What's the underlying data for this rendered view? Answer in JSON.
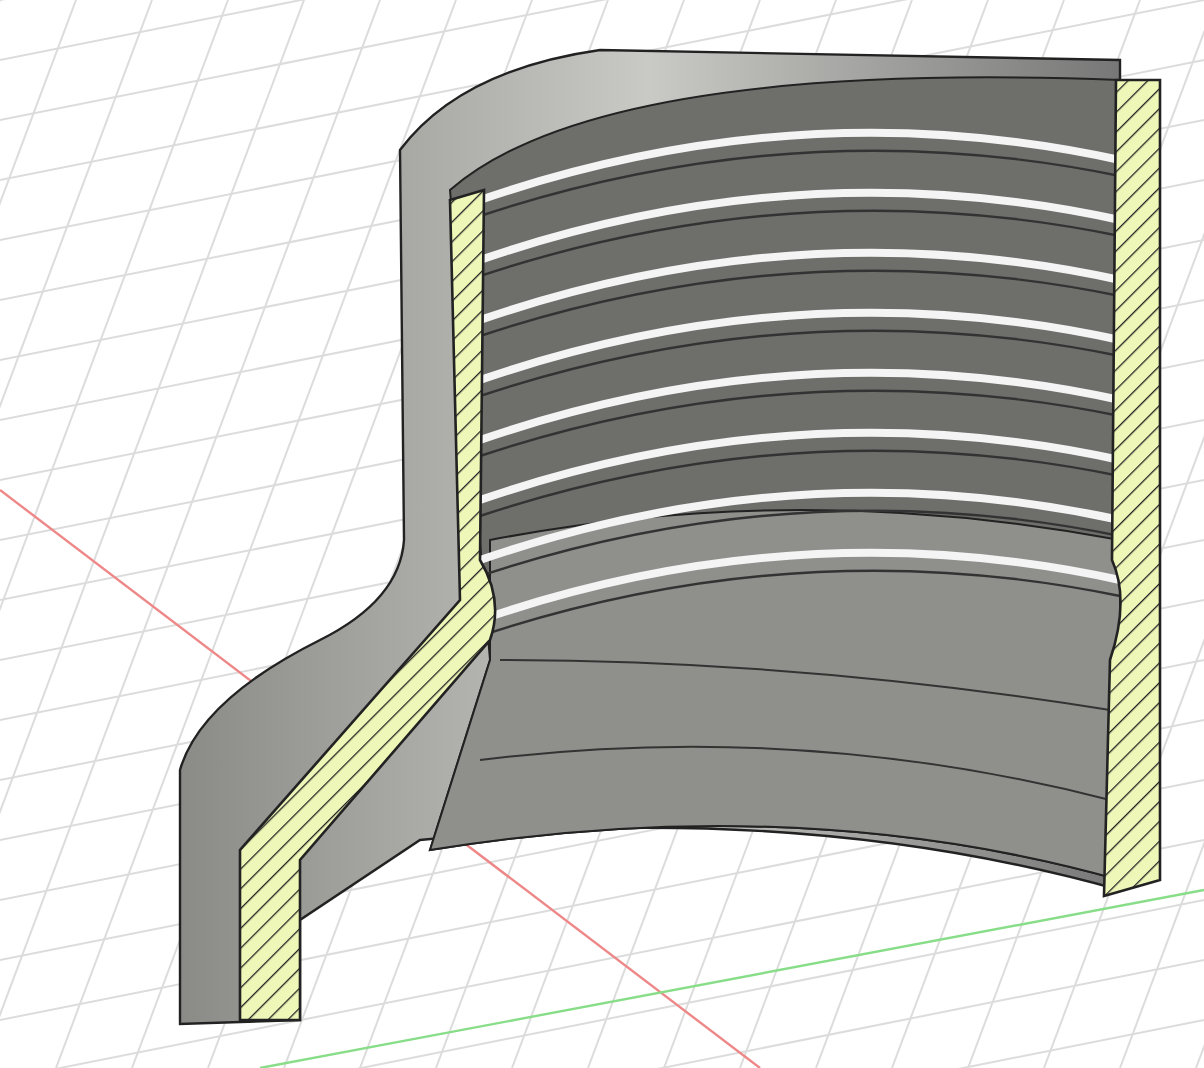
{
  "scene": {
    "grid": true,
    "axes": true
  }
}
